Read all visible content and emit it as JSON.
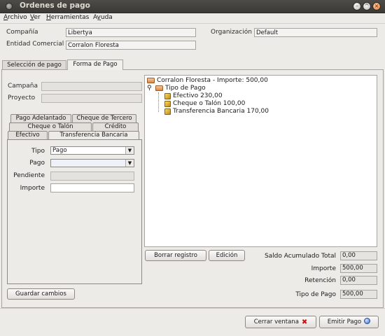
{
  "window": {
    "title": "Ordenes de pago"
  },
  "menu": [
    {
      "pre": "",
      "u": "A",
      "rest": "rchivo"
    },
    {
      "pre": "",
      "u": "V",
      "rest": "er"
    },
    {
      "pre": "",
      "u": "H",
      "rest": "erramientas"
    },
    {
      "pre": "A",
      "u": "y",
      "rest": "uda"
    }
  ],
  "header": {
    "company_label": "Compañía",
    "company_value": "Libertya",
    "org_label": "Organización",
    "org_value": "Default",
    "entity_label": "Entidad Comercial",
    "entity_value": "Corralon Floresta"
  },
  "tabs": {
    "selection": "Selección de pago",
    "payment_form": "Forma de Pago"
  },
  "left": {
    "campaign_label": "Campaña",
    "project_label": "Proyecto",
    "payment_tabs": {
      "advance": "Pago Adelantado",
      "third_party_check": "Cheque de Tercero",
      "check_or_stub": "Cheque o Talón",
      "credit": "Crédito",
      "cash": "Efectivo",
      "bank_transfer": "Transferencia Bancaria"
    },
    "tipo_label": "Tipo",
    "tipo_value": "Pago",
    "pago_label": "Pago",
    "pago_value": "",
    "pendiente_label": "Pendiente",
    "importe_label": "Importe",
    "importe_value": "",
    "save_button": "Guardar cambios"
  },
  "tree": {
    "root": "Corralon Floresta - Importe: 500,00",
    "group": "Tipo de Pago",
    "items": [
      "Efectivo 230,00",
      "Cheque o Talón 100,00",
      "Transferencia Bancaria 170,00"
    ]
  },
  "actions": {
    "delete_record": "Borrar registro",
    "edit": "Edición"
  },
  "summary": {
    "saldo_label": "Saldo Acumulado Total",
    "saldo_value": "0,00",
    "importe_label": "Importe",
    "importe_value": "500,00",
    "retencion_label": "Retención",
    "retencion_value": "0,00",
    "tipo_label": "Tipo de Pago",
    "tipo_value": "500,00"
  },
  "footer": {
    "close_button": "Cerrar ventana",
    "emit_button": "Emitir Pago"
  },
  "icons": {
    "close": "close-icon",
    "maximize": "maximize-icon",
    "minimize": "minimize-icon",
    "window_menu": "window-menu-icon",
    "folder": "folder-icon",
    "payment": "payment-icon",
    "delete": "red-x-icon",
    "go": "globe-icon"
  }
}
